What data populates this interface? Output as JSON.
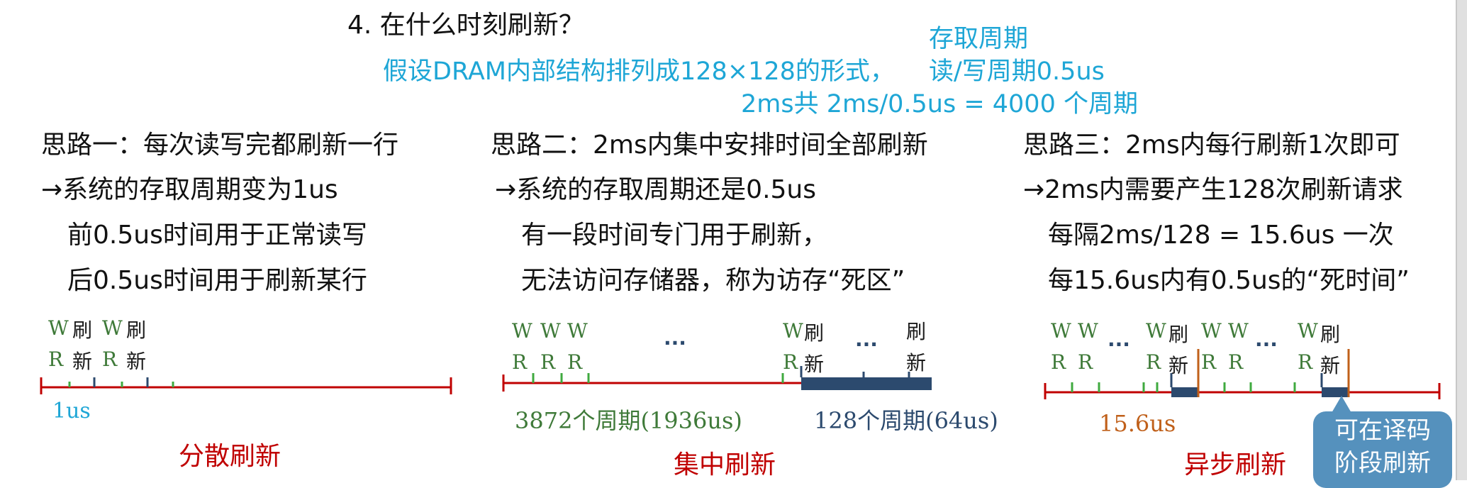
{
  "title": "4. 在什么时刻刷新？",
  "premise": {
    "line1": "假设DRAM内部结构排列成128×128的形式，",
    "access_label": "存取周期",
    "rw_label": "读/写周期0.5us",
    "calc": "2ms共 2ms/0.5us = 4000 个周期"
  },
  "approach1": {
    "heading": "思路一：每次读写完都刷新一行",
    "result": "系统的存取周期变为1us",
    "detail1": "前0.5us时间用于正常读写",
    "detail2": "后0.5us时间用于刷新某行"
  },
  "approach2": {
    "heading": "思路二：2ms内集中安排时间全部刷新",
    "result": "系统的存取周期还是0.5us",
    "detail1": "有一段时间专门用于刷新，",
    "detail2": "无法访问存储器，称为访存“死区”"
  },
  "approach3": {
    "heading": "思路三：2ms内每行刷新1次即可",
    "result": "2ms内需要产生128次刷新请求",
    "detail1": "每隔2ms/128 = 15.6us 一次",
    "detail2": "每15.6us内有0.5us的“死时间”"
  },
  "arrow": "→",
  "marks": {
    "w": "W",
    "r": "R",
    "shua": "刷",
    "xin": "新",
    "ellipsis": "..."
  },
  "diagram1": {
    "unit_label": "1us",
    "name": "分散刷新"
  },
  "diagram2": {
    "normal_label": "3872个周期(1936us)",
    "refresh_label": "128个周期(64us)",
    "name": "集中刷新"
  },
  "diagram3": {
    "interval_label": "15.6us",
    "name": "异步刷新",
    "callout": [
      "可在译码",
      "阶段刷新"
    ]
  },
  "colors": {
    "cyan": "#1ea6d6",
    "red": "#c00000",
    "navy": "#2c4a6e",
    "green": "#3faa3f",
    "orange": "#c0601a",
    "callout": "#5591bd"
  }
}
